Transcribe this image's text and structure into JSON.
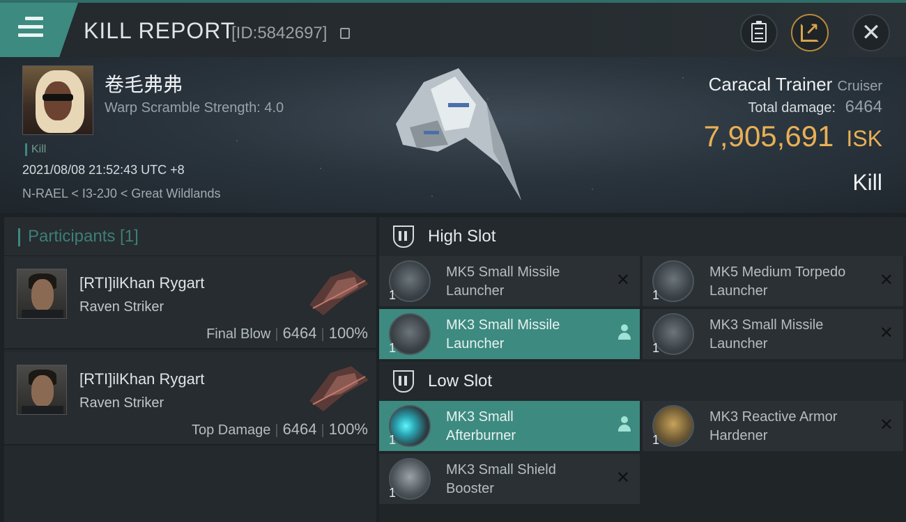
{
  "header": {
    "title": "KILL REPORT",
    "report_id": "[ID:5842697]"
  },
  "victim": {
    "name": "卷毛弗弗",
    "warp_scramble": "Warp Scramble Strength: 4.0",
    "tag": "Kill",
    "timestamp": "2021/08/08 21:52:43 UTC +8",
    "location": "N-RAEL < I3-2J0 < Great Wildlands",
    "ship_name": "Caracal Trainer",
    "ship_class": "Cruiser",
    "total_damage_label": "Total damage:",
    "total_damage": "6464",
    "isk_value": "7,905,691",
    "isk_unit": "ISK",
    "result": "Kill"
  },
  "participants": {
    "header": "Participants [1]",
    "rows": [
      {
        "name": "[RTI]ilKhan Rygart",
        "ship": "Raven Striker",
        "label": "Final Blow",
        "damage": "6464",
        "percent": "100%"
      },
      {
        "name": "[RTI]ilKhan Rygart",
        "ship": "Raven Striker",
        "label": "Top Damage",
        "damage": "6464",
        "percent": "100%"
      }
    ]
  },
  "fitting": {
    "high_slot": {
      "label": "High Slot",
      "modules": [
        {
          "line1": "MK5 Small Missile",
          "line2": "Launcher",
          "qty": "1"
        },
        {
          "line1": "MK5 Medium Torpedo",
          "line2": " Launcher",
          "qty": "1"
        },
        {
          "line1": "MK3 Small Missile",
          "line2": "Launcher",
          "qty": "1"
        },
        {
          "line1": "MK3 Small Missile",
          "line2": "Launcher",
          "qty": "1"
        }
      ]
    },
    "low_slot": {
      "label": "Low Slot",
      "modules": [
        {
          "line1": "MK3 Small",
          "line2": "Afterburner",
          "qty": "1"
        },
        {
          "line1": "MK3 Reactive Armor",
          "line2": "Hardener",
          "qty": "1"
        },
        {
          "line1": "MK3 Small Shield",
          "line2": "Booster",
          "qty": "1"
        }
      ]
    }
  },
  "colors": {
    "accent": "#3d8a80",
    "isk": "#e8b055",
    "background": "#1c2125"
  },
  "icons": {
    "menu": "menu-icon",
    "copy": "copy-icon",
    "clipboard": "clipboard-icon",
    "share": "share-icon",
    "close": "close-icon",
    "remove": "x-icon",
    "user": "user-icon"
  }
}
